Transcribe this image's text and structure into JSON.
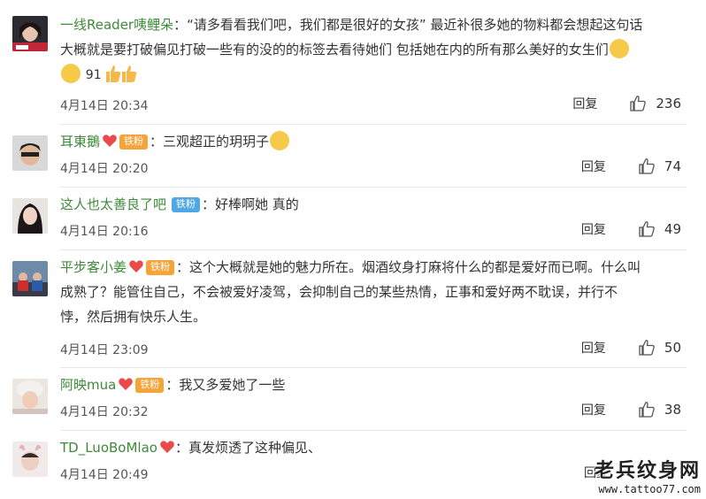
{
  "comments": [
    {
      "user": "一线Reader咦鲤朵",
      "text_line1": "：“请多看看我们吧，我们都是很好的女孩” 最近补很多她的物料都会想起这句话",
      "text_line2": "大概就是要打破偏见打破一些有的没的的标签去看待她们 包括她在内的所有那么美好的女生们",
      "inline_count": "91",
      "time": "4月14日 20:34",
      "reply": "回复",
      "likes": "236"
    },
    {
      "user": "耳東鵝",
      "badge": "铁粉",
      "text": "：三观超正的玥玥子",
      "time": "4月14日 20:20",
      "reply": "回复",
      "likes": "74"
    },
    {
      "user": "这人也太善良了吧",
      "badge": "铁粉",
      "text": "：好棒啊她 真的",
      "time": "4月14日 20:16",
      "reply": "回复",
      "likes": "49"
    },
    {
      "user": "平步客小姜",
      "badge": "铁粉",
      "text_line1": "：这个大概就是她的魅力所在。烟酒纹身打麻将什么的都是爱好而已啊。什么叫",
      "text_line2": "成熟了？能管住自己，不会被爱好凌驾，会抑制自己的某些热情，正事和爱好两不耽误，并行不",
      "text_line3": "悖，然后拥有快乐人生。",
      "time": "4月14日 23:09",
      "reply": "回复",
      "likes": "50"
    },
    {
      "user": "阿映mua",
      "badge": "铁粉",
      "text": "：我又多爱她了一些",
      "time": "4月14日 20:32",
      "reply": "回复",
      "likes": "38"
    },
    {
      "user": "TD_LuoBoMlao",
      "text": "：真发烦透了这种偏见、",
      "time": "4月14日 20:49",
      "reply": "回复"
    }
  ],
  "watermark": {
    "main": "老兵纹身网",
    "url": "www.tattoo77.com"
  },
  "colors": {
    "username": "#3e8a3a",
    "badge_orange": "#f5a43a",
    "badge_blue": "#4fa7e3"
  }
}
